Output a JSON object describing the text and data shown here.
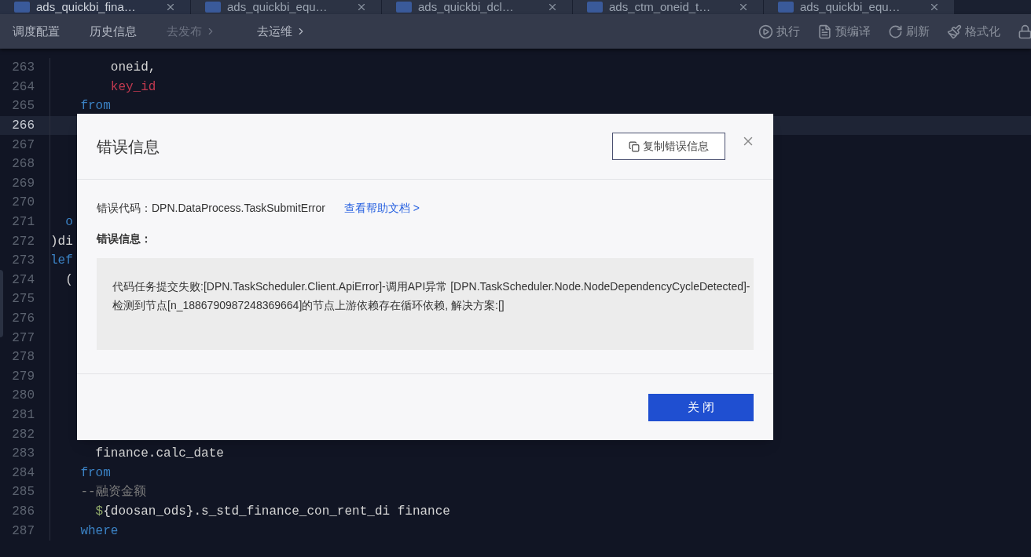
{
  "tabs": [
    {
      "label": "ads_quickbi_fina…",
      "selected": true
    },
    {
      "label": "ads_quickbi_equ…",
      "selected": false
    },
    {
      "label": "ads_quickbi_dcl…",
      "selected": false
    },
    {
      "label": "ads_ctm_oneid_t…",
      "selected": false
    },
    {
      "label": "ads_quickbi_equ…",
      "selected": false
    }
  ],
  "toolbar": {
    "left": [
      {
        "label": "调度配置",
        "kind": "plain",
        "disabled": false
      },
      {
        "label": "历史信息",
        "kind": "plain",
        "disabled": false
      },
      {
        "label": "去发布",
        "kind": "link",
        "disabled": true
      },
      {
        "label": "去运维",
        "kind": "link",
        "disabled": false
      }
    ],
    "right": [
      {
        "label": "执行",
        "kind": "play"
      },
      {
        "label": "预编译",
        "kind": "doc"
      },
      {
        "label": "刷新",
        "kind": "refresh"
      },
      {
        "label": "格式化",
        "kind": "brush"
      },
      {
        "kind": "lock"
      }
    ]
  },
  "editor": {
    "lines": [
      {
        "number": "263",
        "current": false,
        "tokens": [
          {
            "text": "        oneid,",
            "kind": "ident"
          }
        ]
      },
      {
        "number": "264",
        "current": false,
        "tokens": [
          {
            "text": "        key_id",
            "kind": "field"
          }
        ]
      },
      {
        "number": "265",
        "current": false,
        "tokens": [
          {
            "text": "    from",
            "kind": "keyword"
          }
        ]
      },
      {
        "number": "266",
        "current": true
      },
      {
        "number": "267",
        "current": false
      },
      {
        "number": "268",
        "current": false
      },
      {
        "number": "269",
        "current": false
      },
      {
        "number": "270",
        "current": false
      },
      {
        "number": "271",
        "current": false,
        "tokens": [
          {
            "text": "  o",
            "kind": "keyword"
          }
        ]
      },
      {
        "number": "272",
        "current": false,
        "tokens": [
          {
            "text": ")di",
            "kind": "ident"
          }
        ]
      },
      {
        "number": "273",
        "current": false,
        "tokens": [
          {
            "text": "lef",
            "kind": "keyword"
          }
        ]
      },
      {
        "number": "274",
        "current": false,
        "tokens": [
          {
            "text": "  (",
            "kind": "ident"
          }
        ]
      },
      {
        "number": "275",
        "current": false
      },
      {
        "number": "276",
        "current": false
      },
      {
        "number": "277",
        "current": false
      },
      {
        "number": "278",
        "current": false
      },
      {
        "number": "279",
        "current": false
      },
      {
        "number": "280",
        "current": false
      },
      {
        "number": "281",
        "current": false
      },
      {
        "number": "282",
        "current": false
      },
      {
        "number": "283",
        "current": false,
        "tokens": [
          {
            "text": "      finance.calc_date",
            "kind": "ident"
          }
        ]
      },
      {
        "number": "284",
        "current": false,
        "tokens": [
          {
            "text": "    from",
            "kind": "keyword"
          }
        ]
      },
      {
        "number": "285",
        "current": false,
        "tokens": [
          {
            "text": "    --融资金额",
            "kind": "comment"
          }
        ]
      },
      {
        "number": "286",
        "current": false,
        "tokens": [
          {
            "text": "      $",
            "kind": "variable"
          },
          {
            "text": "{doosan_ods}.s_std_finance_con_rent_di finance",
            "kind": "ident"
          }
        ]
      },
      {
        "number": "287",
        "current": false,
        "tokens": [
          {
            "text": "    where",
            "kind": "keyword"
          }
        ]
      }
    ]
  },
  "dialog": {
    "title": "错误信息",
    "copy_button": "复制错误信息",
    "code_label": "错误代码：",
    "code_value": "DPN.DataProcess.TaskSubmitError",
    "help_link": "查看帮助文档 >",
    "message_label": "错误信息：",
    "message": "代码任务提交失败:[DPN.TaskScheduler.Client.ApiError]-调用API异常 [DPN.TaskScheduler.Node.NodeDependencyCycleDetected]-检测到节点[n_1886790987248369664]的节点上游依赖存在循环依赖, 解决方案:[]",
    "close_button": "关 闭"
  }
}
